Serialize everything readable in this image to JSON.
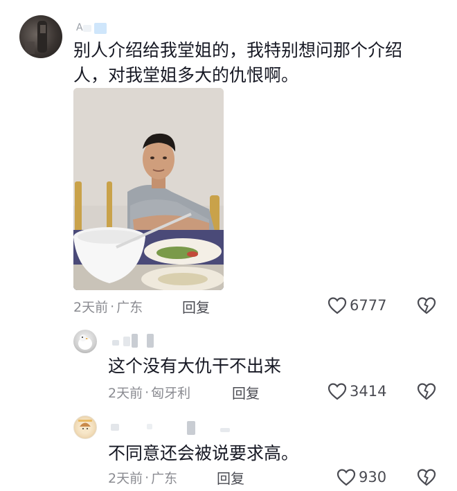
{
  "comments": [
    {
      "text_line1": "别人介绍给我堂姐的，我特别想问那个介绍",
      "text_line2": "人，对我堂姐多大的仇恨啊。",
      "username_initial": "A",
      "time": "2天前",
      "location": "广东",
      "reply_label": "回复",
      "likes": "6777"
    },
    {
      "text": "这个没有大仇干不出来",
      "time": "2天前",
      "location": "匈牙利",
      "reply_label": "回复",
      "likes": "3414"
    },
    {
      "text": "不同意还会被说要求高。",
      "time": "2天前",
      "location": "广东",
      "reply_label": "回复",
      "likes": "930"
    }
  ],
  "separator": "·",
  "icons": {
    "like": "heart-outline-icon",
    "dislike": "broken-heart-icon"
  }
}
